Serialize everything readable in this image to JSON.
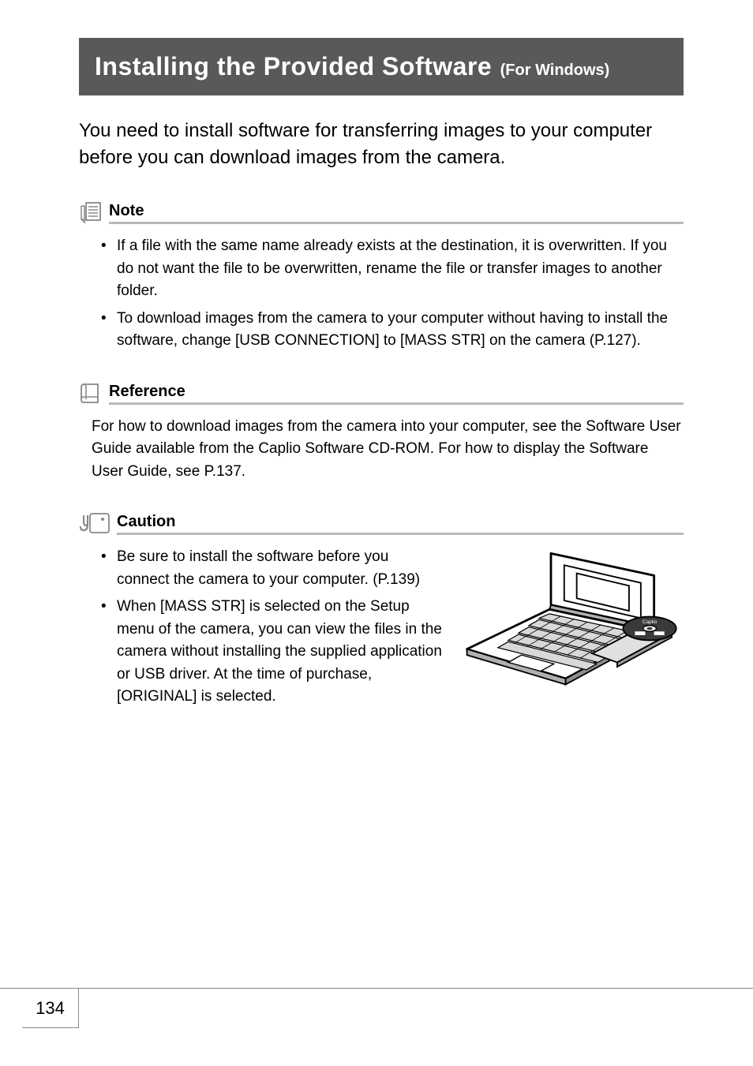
{
  "header": {
    "title_main": "Installing the Provided Software",
    "title_sub": "(For Windows)"
  },
  "intro": "You need to install software for transferring images to your computer before you can download images from the camera.",
  "note": {
    "label": "Note",
    "bullets": [
      "If a file with the same name already exists at the destination, it is overwritten. If you do not want the file to be overwritten, rename the file or transfer images to another folder.",
      "To download images from the camera to your computer without having to install the software, change [USB CONNECTION] to [MASS STR] on the camera (P.127)."
    ]
  },
  "reference": {
    "label": "Reference",
    "body": "For how to download images from the camera into your computer, see the Software User Guide available from the Caplio Software CD-ROM. For how to display the Software User Guide, see P.137."
  },
  "caution": {
    "label": "Caution",
    "bullets": [
      "Be sure to install the software before you connect the camera to your computer. (P.139)",
      "When [MASS STR] is selected on the Setup menu of the camera, you can view the files in the camera without installing the supplied application or USB driver. At the time of purchase, [ORIGINAL] is selected."
    ]
  },
  "page_number": "134"
}
